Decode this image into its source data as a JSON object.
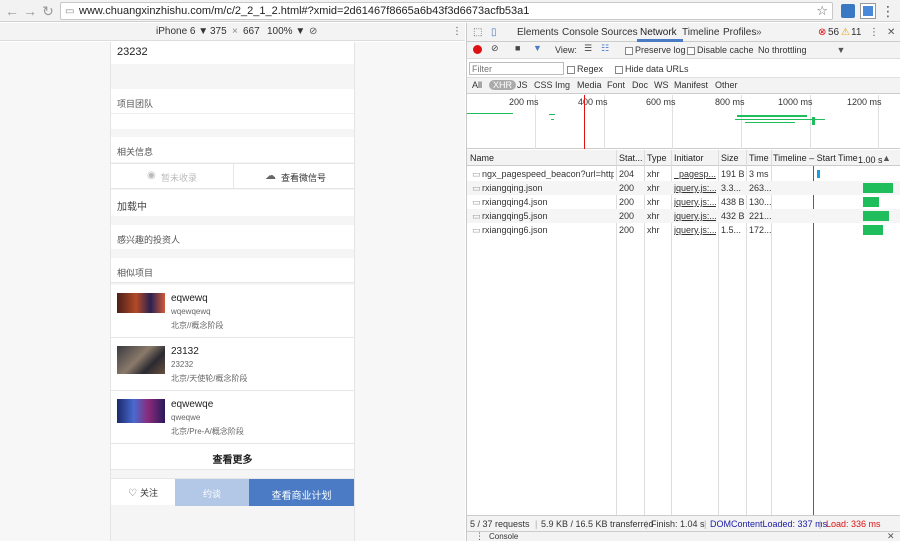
{
  "browser": {
    "url": "www.chuangxinzhishu.com/m/c/2_2_1_2.html#?xmid=2d61467f8665a6b43f3d6673acfb53a1"
  },
  "device_toolbar": {
    "device": "iPhone 6 ▼",
    "width": "375",
    "times": "×",
    "height": "667",
    "zoom": "100% ▼"
  },
  "phone": {
    "top_value": "23232",
    "team_label": "项目团队",
    "related_label": "相关信息",
    "not_collected": "暂未收录",
    "wechat": "查看微信号",
    "loading": "加载中",
    "investors_label": "感兴趣的投资人",
    "similar_label": "相似项目",
    "projects": [
      {
        "title": "eqwewq",
        "sub": "wqewqewq",
        "loc": "北京//概念阶段"
      },
      {
        "title": "23132",
        "sub": "23232",
        "loc": "北京/天使轮/概念阶段"
      },
      {
        "title": "eqwewqe",
        "sub": "qweqwe",
        "loc": "北京/Pre-A/概念阶段"
      }
    ],
    "see_more": "查看更多",
    "follow": "关注",
    "invite": "约谈",
    "business_plan": "查看商业计划"
  },
  "devtools": {
    "tabs": [
      "Elements",
      "Console",
      "Sources",
      "Network",
      "Timeline",
      "Profiles"
    ],
    "errors": "56",
    "warnings": "11",
    "view_label": "View:",
    "preserve_log": "Preserve log",
    "disable_cache": "Disable cache",
    "throttling": "No throttling",
    "filter_placeholder": "Filter",
    "regex": "Regex",
    "hide_data_urls": "Hide data URLs",
    "types": [
      "All",
      "XHR",
      "JS",
      "CSS",
      "Img",
      "Media",
      "Font",
      "Doc",
      "WS",
      "Manifest",
      "Other"
    ],
    "ticks": [
      "200 ms",
      "400 ms",
      "600 ms",
      "800 ms",
      "1000 ms",
      "1200 ms"
    ],
    "columns": [
      "Name",
      "Stat...",
      "Type",
      "Initiator",
      "Size",
      "Time",
      "Timeline – Start Time",
      "1.00 s"
    ],
    "rows": [
      {
        "name": "ngx_pagespeed_beacon?url=http%...",
        "status": "204",
        "type": "xhr",
        "initiator": "_pagesp...",
        "size": "191 B",
        "time": "3 ms"
      },
      {
        "name": "rxiangqing.json",
        "status": "200",
        "type": "xhr",
        "initiator": "jquery.js:...",
        "size": "3.3...",
        "time": "263..."
      },
      {
        "name": "rxiangqing4.json",
        "status": "200",
        "type": "xhr",
        "initiator": "jquery.js:...",
        "size": "438 B",
        "time": "130..."
      },
      {
        "name": "rxiangqing5.json",
        "status": "200",
        "type": "xhr",
        "initiator": "jquery.js:...",
        "size": "432 B",
        "time": "221..."
      },
      {
        "name": "rxiangqing6.json",
        "status": "200",
        "type": "xhr",
        "initiator": "jquery.js:...",
        "size": "1.5...",
        "time": "172..."
      }
    ],
    "status": {
      "requests": "5 / 37 requests",
      "transferred": "5.9 KB / 16.5 KB transferred",
      "finish": "Finish: 1.04 s",
      "dcl": "DOMContentLoaded: 337 ms",
      "load": "Load: 336 ms"
    },
    "console_tab": "Console"
  },
  "colors": {
    "accent": "#4a7bc4",
    "record": "#d11",
    "dcl": "#1a1aa6",
    "load": "#d11",
    "bar": "#1fbd5c"
  }
}
